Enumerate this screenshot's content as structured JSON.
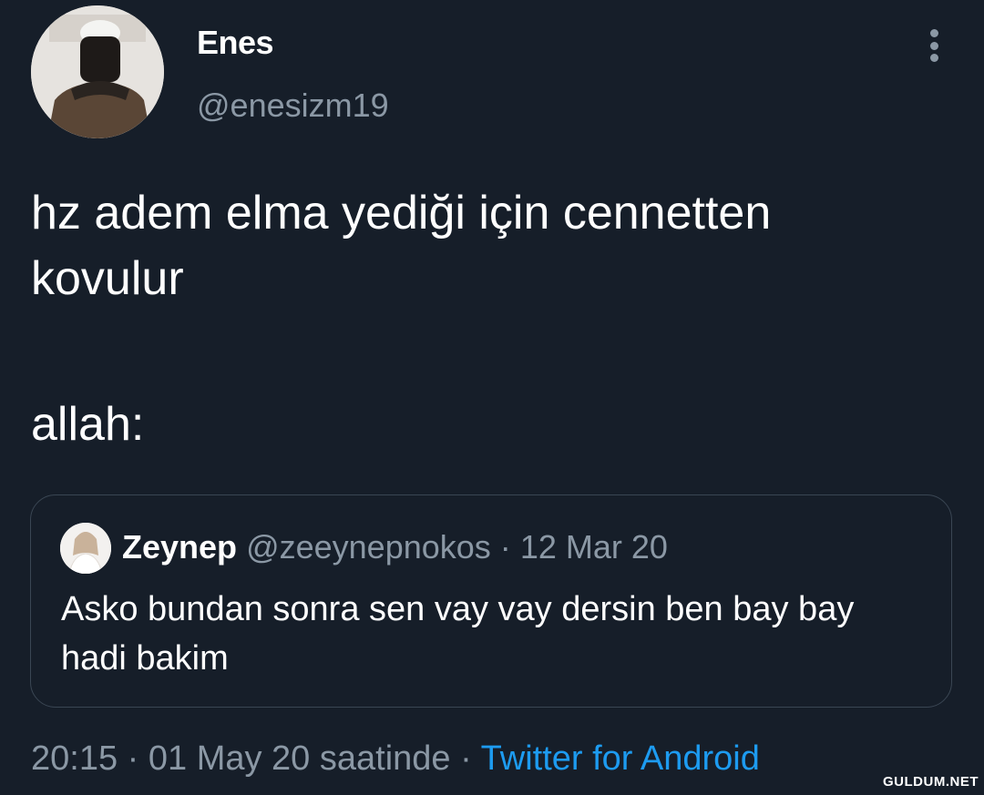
{
  "author": {
    "name": "Enes",
    "handle": "@enesizm19",
    "avatar_icon": "profile-photo"
  },
  "tweet": {
    "lines": [
      "hz adem elma yediği için cennetten",
      "kovulur",
      "allah:"
    ]
  },
  "quote": {
    "name": "Zeynep",
    "handle": "@zeeynepnokos",
    "separator": "·",
    "date": "12 Mar 20",
    "lines": [
      "Asko bundan sonra sen vay vay dersin ben bay bay",
      "hadi bakim"
    ]
  },
  "footer": {
    "time": "20:15",
    "sep1": "·",
    "date": "01 May 20 saatinde",
    "sep2": "·",
    "source": "Twitter for Android"
  },
  "watermark": "GULDUM.NET",
  "colors": {
    "background": "#161e29",
    "secondary_text": "#8b98a5",
    "link": "#1d9bf0"
  }
}
